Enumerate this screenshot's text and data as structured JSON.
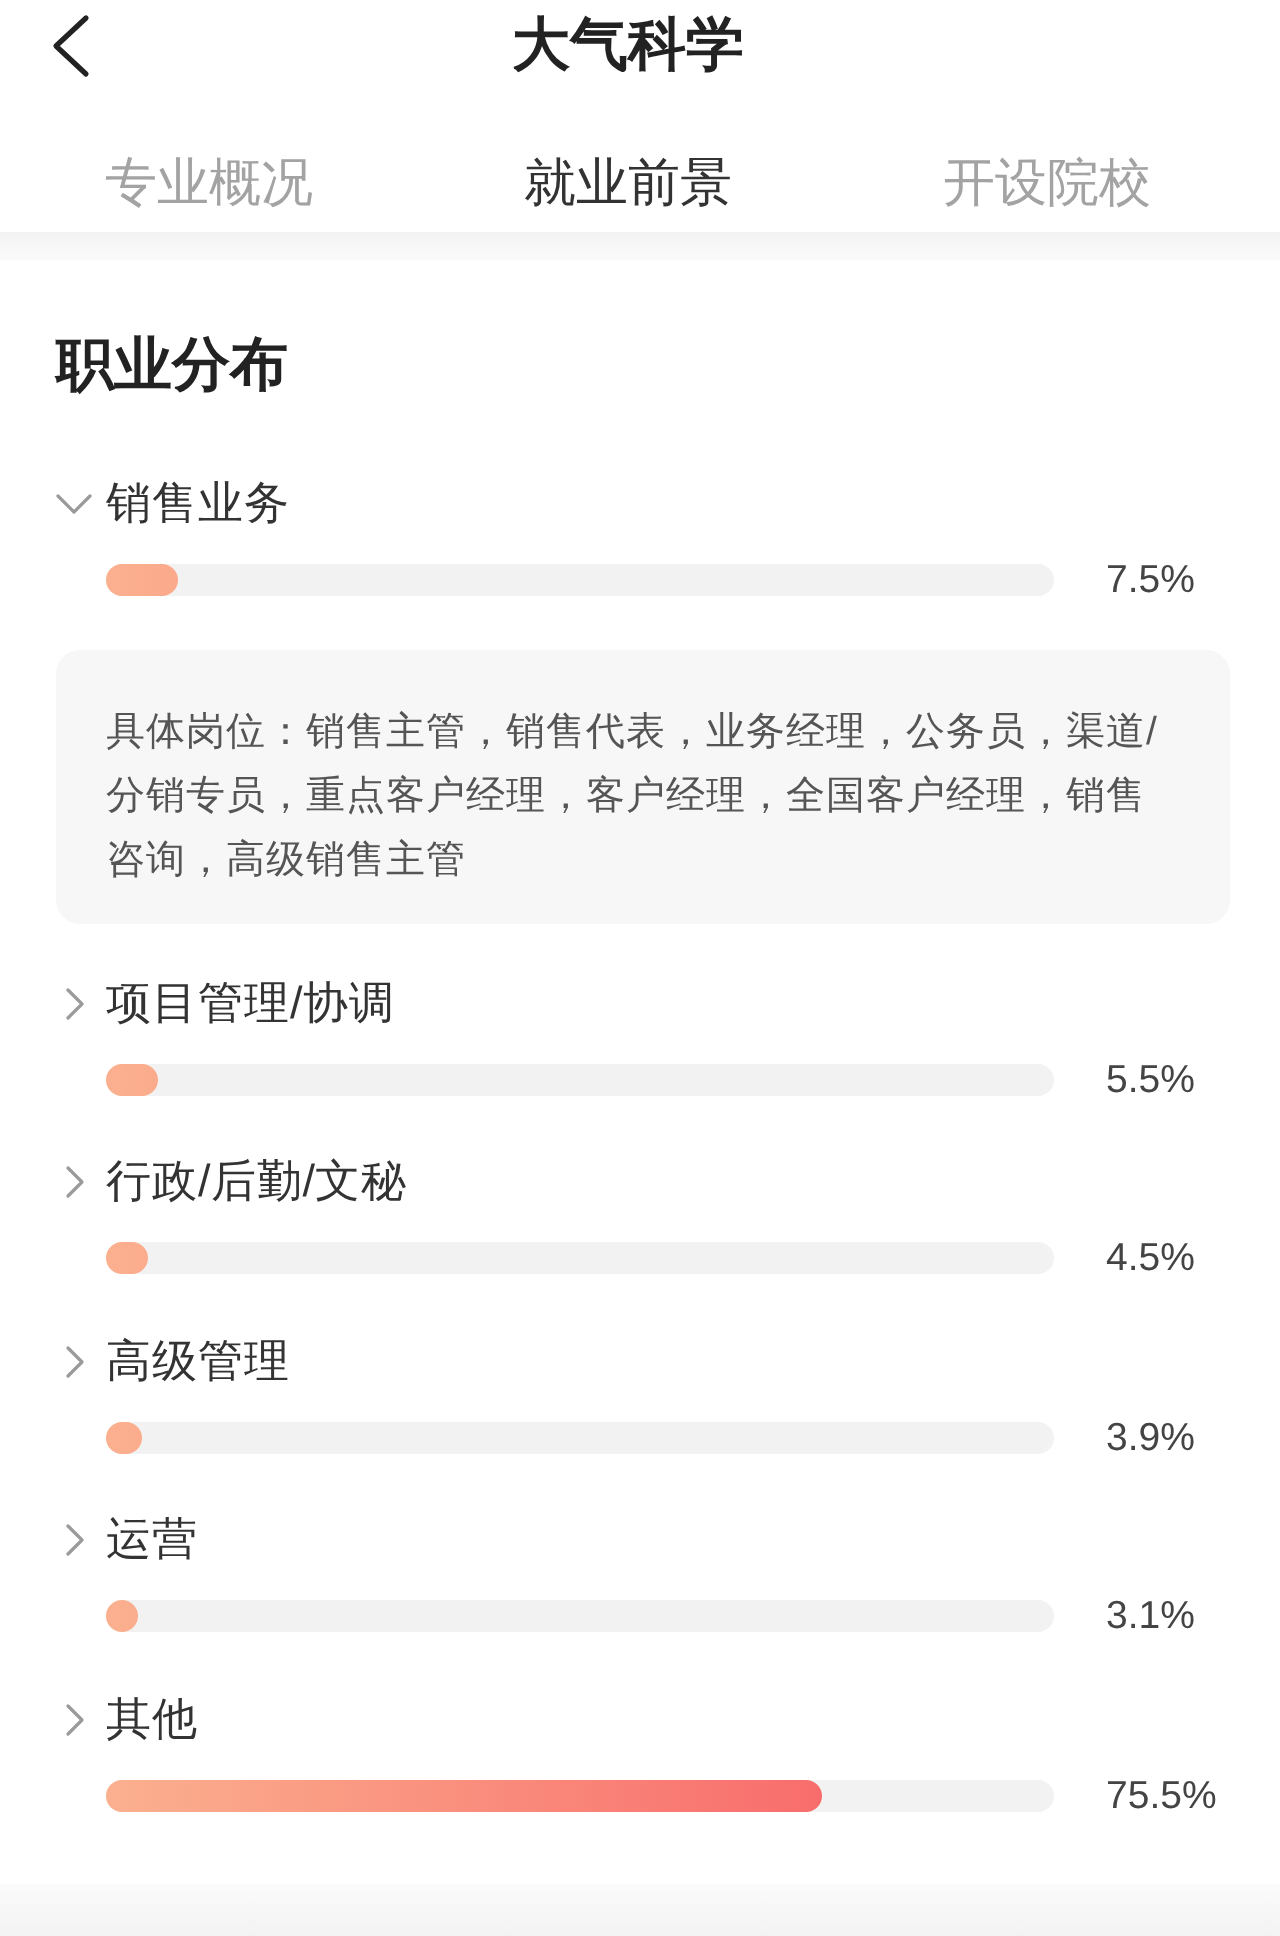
{
  "header": {
    "title": "大气科学"
  },
  "tabs": [
    {
      "label": "专业概况",
      "selected": false
    },
    {
      "label": "就业前景",
      "selected": true
    },
    {
      "label": "开设院校",
      "selected": false
    }
  ],
  "section": {
    "title": "职业分布"
  },
  "careers": [
    {
      "name": "销售业务",
      "expanded": true,
      "level": 0.075,
      "reading": "7.5%",
      "detail": "具体岗位：销售主管，销售代表，业务经理，公务员，渠道/分销专员，重点客户经理，客户经理，全国客户经理，销售咨询，高级销售主管"
    },
    {
      "name": "项目管理/协调",
      "expanded": false,
      "level": 0.055,
      "reading": "5.5%"
    },
    {
      "name": "行政/后勤/文秘",
      "expanded": false,
      "level": 0.045,
      "reading": "4.5%"
    },
    {
      "name": "高级管理",
      "expanded": false,
      "level": 0.039,
      "reading": "3.9%"
    },
    {
      "name": "运营",
      "expanded": false,
      "level": 0.031,
      "reading": "3.1%"
    },
    {
      "name": "其他",
      "expanded": false,
      "level": 0.755,
      "reading": "75.5%"
    }
  ]
}
